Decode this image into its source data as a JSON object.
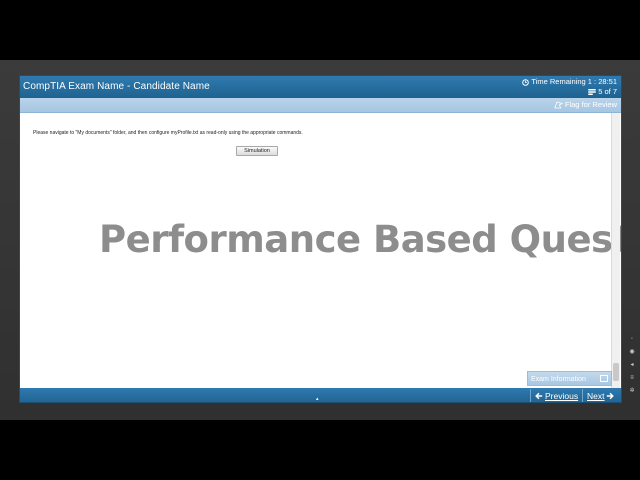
{
  "window": {
    "title": "CompTIA Exam Name - Candidate Name"
  },
  "timer": {
    "label": "Time Remaining 1 : 28:51",
    "progress": "5 of 7"
  },
  "toolbar": {
    "flag_label": "Flag for Review"
  },
  "question": {
    "instruction": "Please navigate to \"My documents\" folder, and then configure myProfile.txt as read-only using the appropriate commands.",
    "simulation_label": "Simulation"
  },
  "overlay": {
    "text": "Performance Based Questions"
  },
  "panel": {
    "exam_info_label": "Exam Information"
  },
  "nav": {
    "previous_label": "Previous",
    "next_label": "Next"
  },
  "icons": {
    "clock": "clock-icon",
    "progress": "progress-icon",
    "flag": "flag-icon",
    "prev": "arrow-left-icon",
    "next": "arrow-right-icon"
  },
  "colors": {
    "titlebar": "#2f7ab0",
    "toolbar": "#b9d4ea",
    "overlay_text": "#7a7a7a"
  }
}
